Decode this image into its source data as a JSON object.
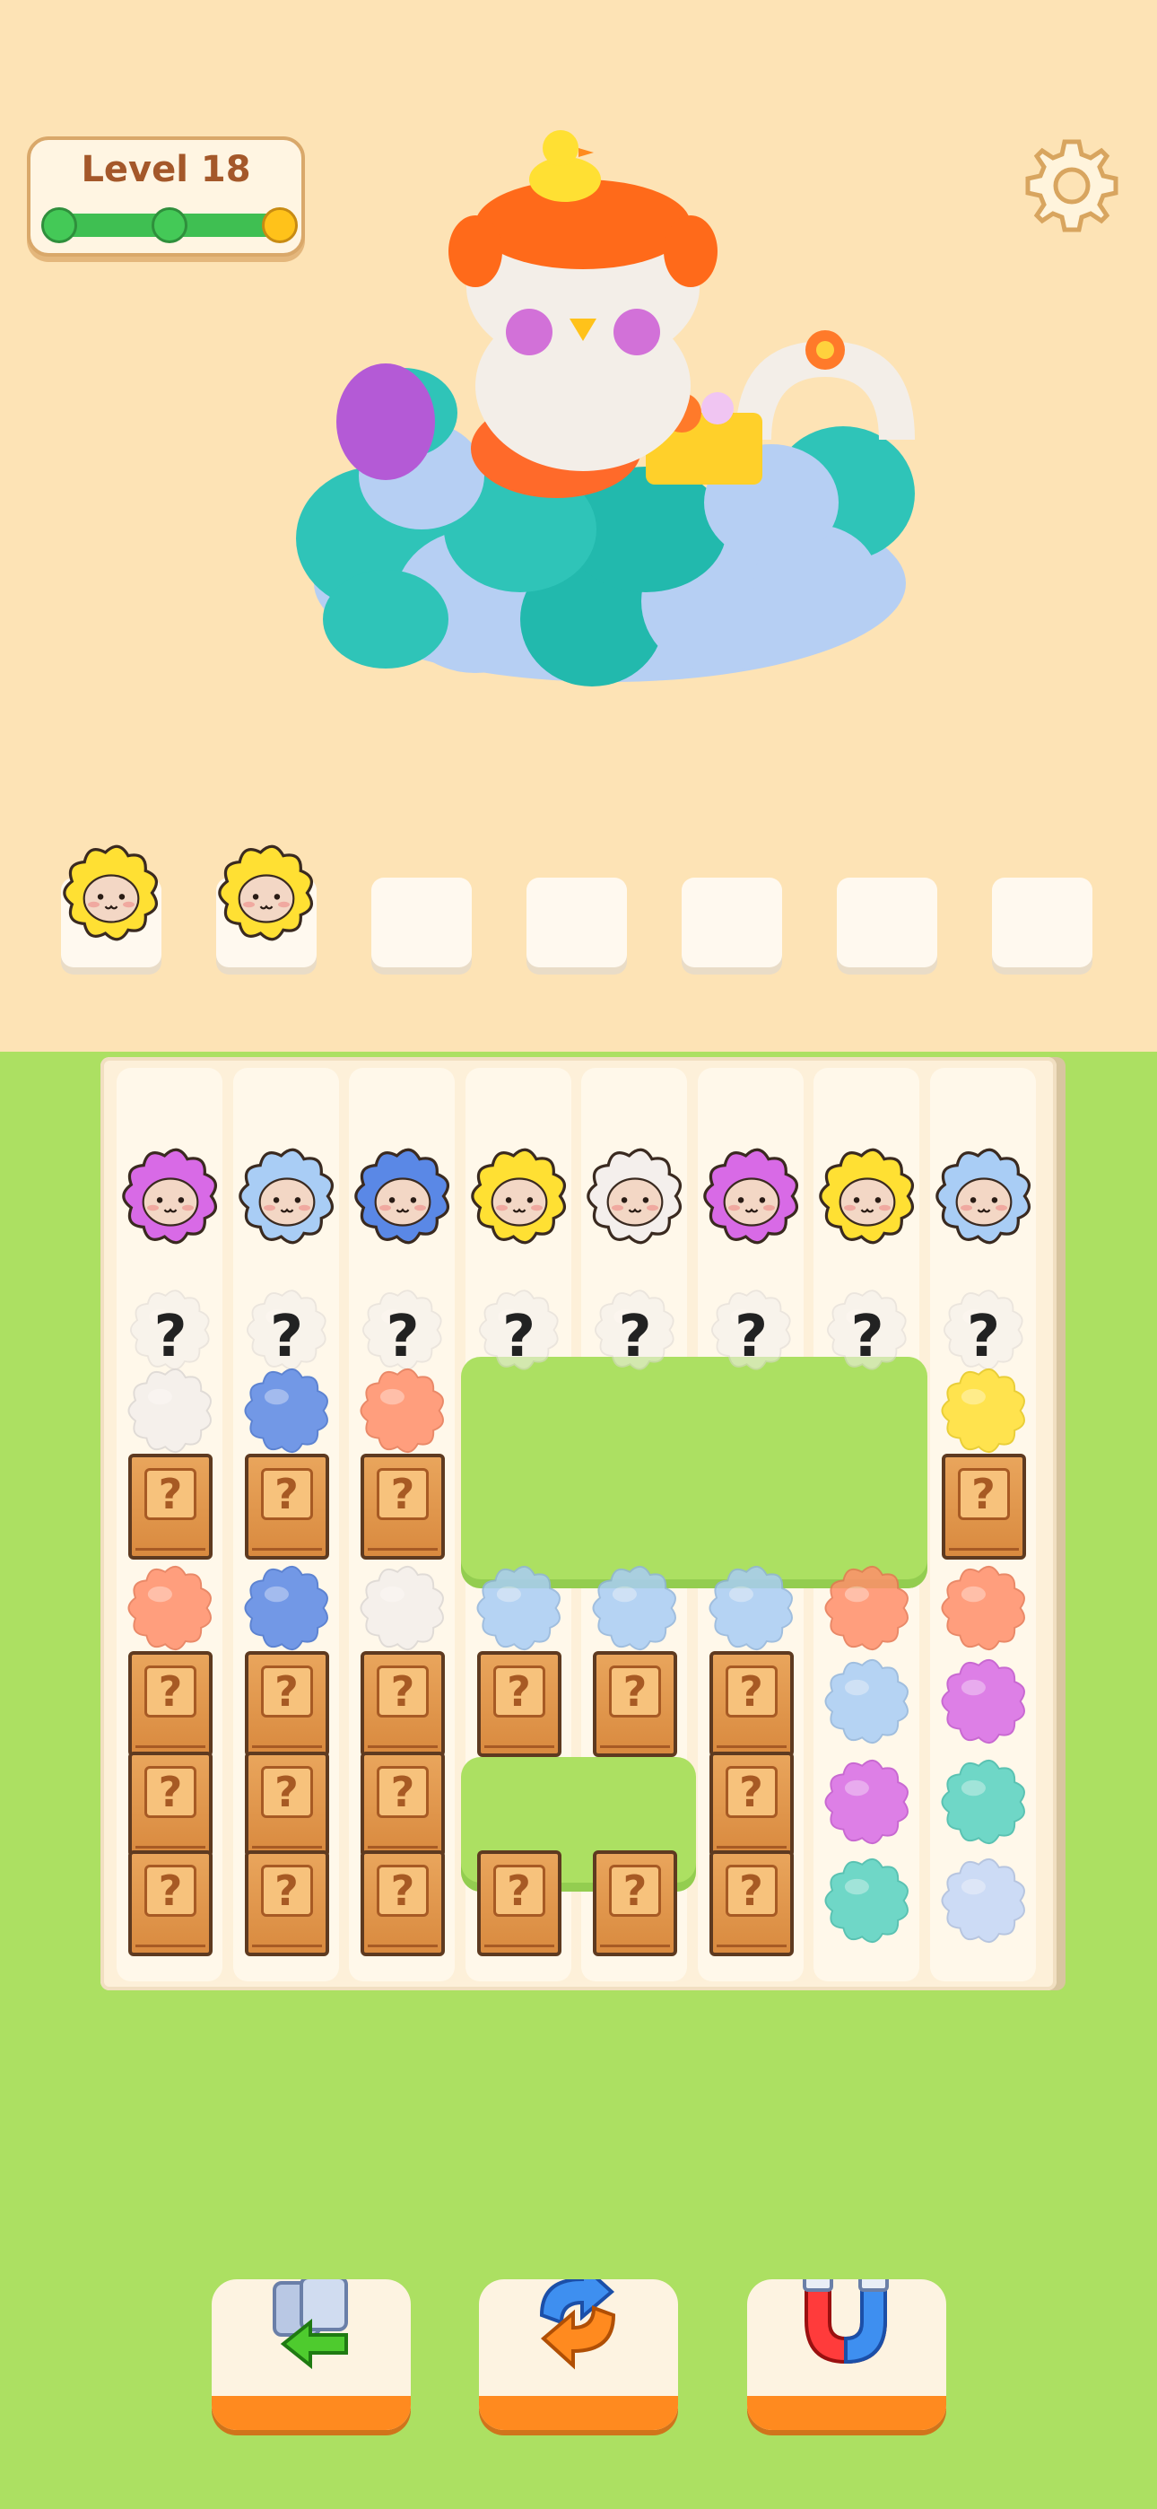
{
  "level": {
    "label": "Level 18",
    "stages_total": 3,
    "stages_reached": 3,
    "current_stage": 3
  },
  "toolbar": {
    "settings_icon": "gear-icon",
    "tools": [
      {
        "name": "undo",
        "icon": "undo-cards-icon"
      },
      {
        "name": "shuffle",
        "icon": "shuffle-arrows-icon"
      },
      {
        "name": "magnet",
        "icon": "magnet-icon"
      }
    ]
  },
  "colors": {
    "yellow": "#ffe033",
    "pink": "#d86ae6",
    "lightblue": "#a9cdf5",
    "blue": "#5a88e6",
    "white": "#f4efec",
    "orange": "#ff8f6b",
    "teal": "#57d2c2",
    "lavender": "#c4d6f7"
  },
  "holding_slots": [
    "yellow",
    "yellow",
    null,
    null,
    null,
    null,
    null
  ],
  "question_mark": "?",
  "board": {
    "top_row": [
      "pink",
      "lightblue",
      "blue",
      "yellow",
      "white",
      "pink",
      "yellow",
      "lightblue"
    ],
    "columns": [
      [
        "q",
        "white",
        "crate",
        "orange",
        "crate",
        "crate",
        "crate"
      ],
      [
        "q",
        "blue",
        "crate",
        "blue",
        "crate",
        "crate",
        "crate"
      ],
      [
        "q",
        "orange",
        "crate",
        "white",
        "crate",
        "crate",
        "crate"
      ],
      [
        "q",
        null,
        null,
        "lightblue",
        "crate",
        null,
        "crate"
      ],
      [
        "q",
        null,
        null,
        "lightblue",
        "crate",
        null,
        "crate"
      ],
      [
        "q",
        null,
        null,
        "lightblue",
        "crate",
        "crate",
        "crate"
      ],
      [
        "q",
        null,
        null,
        "orange",
        "lightblue",
        "pink",
        "teal"
      ],
      [
        "q",
        "yellow",
        "crate",
        "orange",
        "pink",
        "teal",
        "lavender"
      ]
    ]
  }
}
